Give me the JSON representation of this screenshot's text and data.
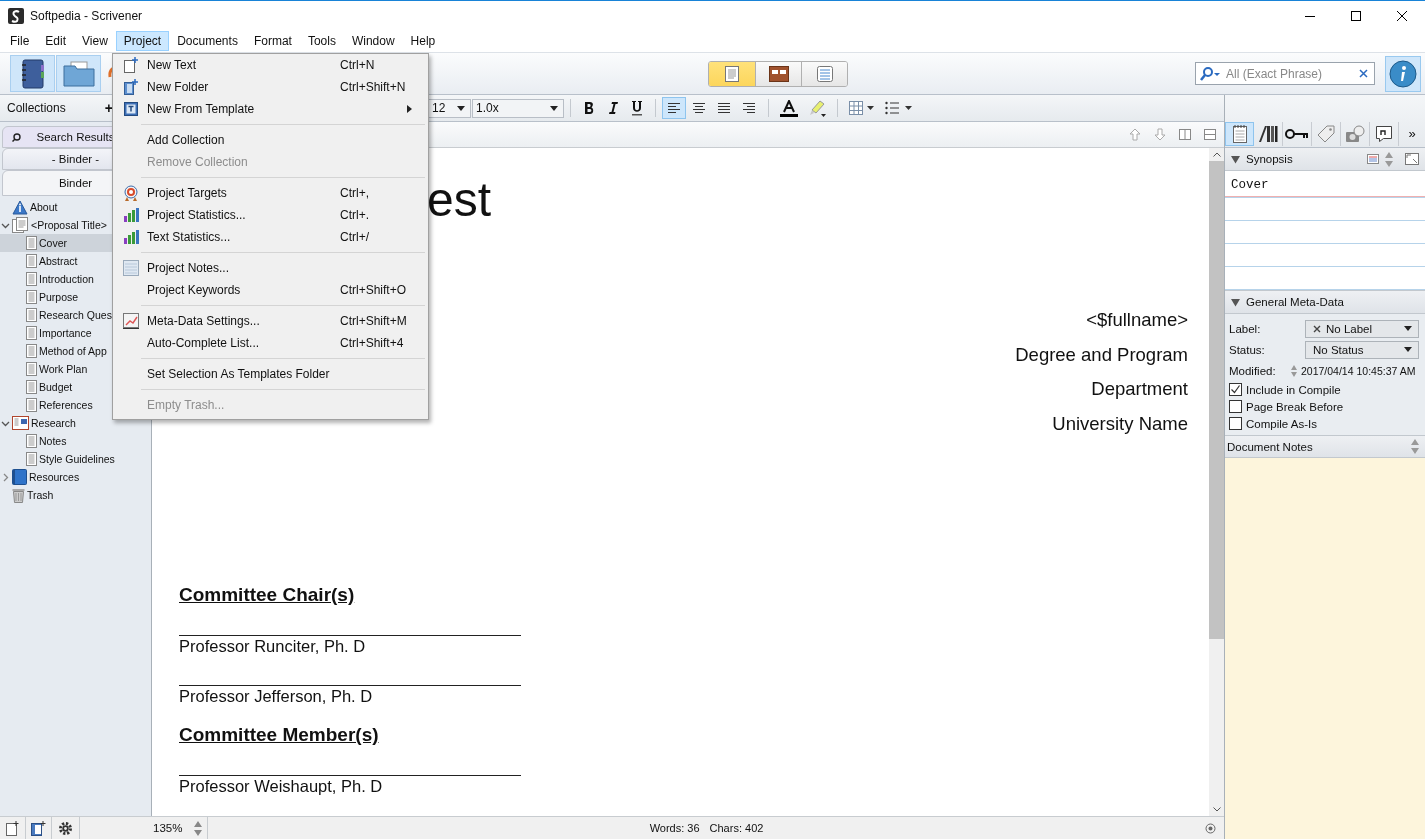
{
  "window": {
    "title": "Softpedia - Scrivener"
  },
  "menubar": [
    {
      "label": "File",
      "selected": false
    },
    {
      "label": "Edit",
      "selected": false
    },
    {
      "label": "View",
      "selected": false
    },
    {
      "label": "Project",
      "selected": true
    },
    {
      "label": "Documents",
      "selected": false
    },
    {
      "label": "Format",
      "selected": false
    },
    {
      "label": "Tools",
      "selected": false
    },
    {
      "label": "Window",
      "selected": false
    },
    {
      "label": "Help",
      "selected": false
    }
  ],
  "toolbar": {
    "view_modes": [
      {
        "selected": true
      },
      {
        "selected": false
      },
      {
        "selected": false
      }
    ],
    "search": {
      "placeholder": "All (Exact Phrase)"
    }
  },
  "format_bar": {
    "collections_label": "Collections",
    "add_label": "+",
    "font_size": "12",
    "line_spacing": "1.0x",
    "alignment": [
      {
        "selected": true
      },
      {
        "selected": false
      },
      {
        "selected": false
      },
      {
        "selected": false
      }
    ]
  },
  "binder": {
    "tabs": [
      {
        "label": "Search Results",
        "selected": false
      },
      {
        "label": "- Binder -",
        "selected": false
      },
      {
        "label": "Binder",
        "selected": true
      }
    ],
    "tree": [
      {
        "kind": "info",
        "label": "About",
        "selected": false
      },
      {
        "kind": "folder",
        "label": "<Proposal Title>",
        "selected": false,
        "expanded": true,
        "children": [
          {
            "kind": "text",
            "label": "Cover",
            "selected": true
          },
          {
            "kind": "text",
            "label": "Abstract",
            "selected": false
          },
          {
            "kind": "text",
            "label": "Introduction",
            "selected": false
          },
          {
            "kind": "text",
            "label": "Purpose",
            "selected": false
          },
          {
            "kind": "text",
            "label": "Research Ques",
            "selected": false
          },
          {
            "kind": "text",
            "label": "Importance",
            "selected": false
          },
          {
            "kind": "text",
            "label": "Method of App",
            "selected": false
          },
          {
            "kind": "text",
            "label": "Work Plan",
            "selected": false
          },
          {
            "kind": "text",
            "label": "Budget",
            "selected": false
          },
          {
            "kind": "text",
            "label": "References",
            "selected": false
          }
        ]
      },
      {
        "kind": "research",
        "label": "Research",
        "selected": false,
        "expanded": true,
        "children": [
          {
            "kind": "text",
            "label": "Notes",
            "selected": false
          },
          {
            "kind": "text",
            "label": "Style Guidelines",
            "selected": false
          }
        ]
      },
      {
        "kind": "resources",
        "label": "Resources",
        "selected": false,
        "expanded": false
      },
      {
        "kind": "trash",
        "label": "Trash",
        "selected": false
      }
    ]
  },
  "project_menu": [
    {
      "kind": "item",
      "label": "New Text",
      "shortcut": "Ctrl+N",
      "disabled": false,
      "submenu": false
    },
    {
      "kind": "item",
      "label": "New Folder",
      "shortcut": "Ctrl+Shift+N",
      "disabled": false,
      "submenu": false
    },
    {
      "kind": "item",
      "label": "New From Template",
      "disabled": false,
      "submenu": true
    },
    {
      "kind": "separator"
    },
    {
      "kind": "item",
      "label": "Add Collection",
      "disabled": false,
      "submenu": false
    },
    {
      "kind": "item",
      "label": "Remove Collection",
      "disabled": true,
      "submenu": false
    },
    {
      "kind": "separator"
    },
    {
      "kind": "item",
      "label": "Project Targets",
      "shortcut": "Ctrl+,",
      "disabled": false,
      "submenu": false
    },
    {
      "kind": "item",
      "label": "Project Statistics...",
      "shortcut": "Ctrl+.",
      "disabled": false,
      "submenu": false
    },
    {
      "kind": "item",
      "label": "Text Statistics...",
      "shortcut": "Ctrl+/",
      "disabled": false,
      "submenu": false
    },
    {
      "kind": "separator"
    },
    {
      "kind": "item",
      "label": "Project Notes...",
      "disabled": false,
      "submenu": false
    },
    {
      "kind": "item",
      "label": "Project Keywords",
      "shortcut": "Ctrl+Shift+O",
      "disabled": false,
      "submenu": false
    },
    {
      "kind": "separator"
    },
    {
      "kind": "item",
      "label": "Meta-Data Settings...",
      "shortcut": "Ctrl+Shift+M",
      "disabled": false,
      "submenu": false
    },
    {
      "kind": "item",
      "label": "Auto-Complete List...",
      "shortcut": "Ctrl+Shift+4",
      "disabled": false,
      "submenu": false
    },
    {
      "kind": "separator"
    },
    {
      "kind": "item",
      "label": "Set Selection As Templates Folder",
      "disabled": false,
      "submenu": false
    },
    {
      "kind": "separator"
    },
    {
      "kind": "item",
      "label": "Empty Trash...",
      "disabled": true,
      "submenu": false
    }
  ],
  "editor": {
    "title": "est",
    "address": [
      "<$fullname>",
      "Degree and Program",
      "Department",
      "University Name"
    ],
    "sections": [
      {
        "heading": "Committee Chair(s)",
        "names": [
          "Professor Runciter, Ph. D",
          "Professor Jefferson, Ph. D"
        ]
      },
      {
        "heading": "Committee Member(s)",
        "names": [
          "Professor Weishaupt, Ph. D"
        ]
      }
    ]
  },
  "inspector": {
    "tabs": [
      {
        "selected": true
      },
      {
        "selected": false
      },
      {
        "selected": false
      },
      {
        "selected": false
      },
      {
        "selected": false
      },
      {
        "selected": false
      }
    ],
    "overflow": "»",
    "synopsis": {
      "title": "Synopsis",
      "text": "Cover"
    },
    "metadata": {
      "title": "General Meta-Data",
      "label_caption": "Label:",
      "label_value": "No Label",
      "status_caption": "Status:",
      "status_value": "No Status",
      "modified_caption": "Modified:",
      "modified_value": "2017/04/14 10:45:37 AM",
      "checkboxes": [
        {
          "label": "Include in Compile",
          "checked": true
        },
        {
          "label": "Page Break Before",
          "checked": false
        },
        {
          "label": "Compile As-Is",
          "checked": false
        }
      ]
    },
    "notes_title": "Document Notes"
  },
  "footer": {
    "zoom": "135%",
    "words": "Words: 36",
    "chars": "Chars: 402"
  }
}
